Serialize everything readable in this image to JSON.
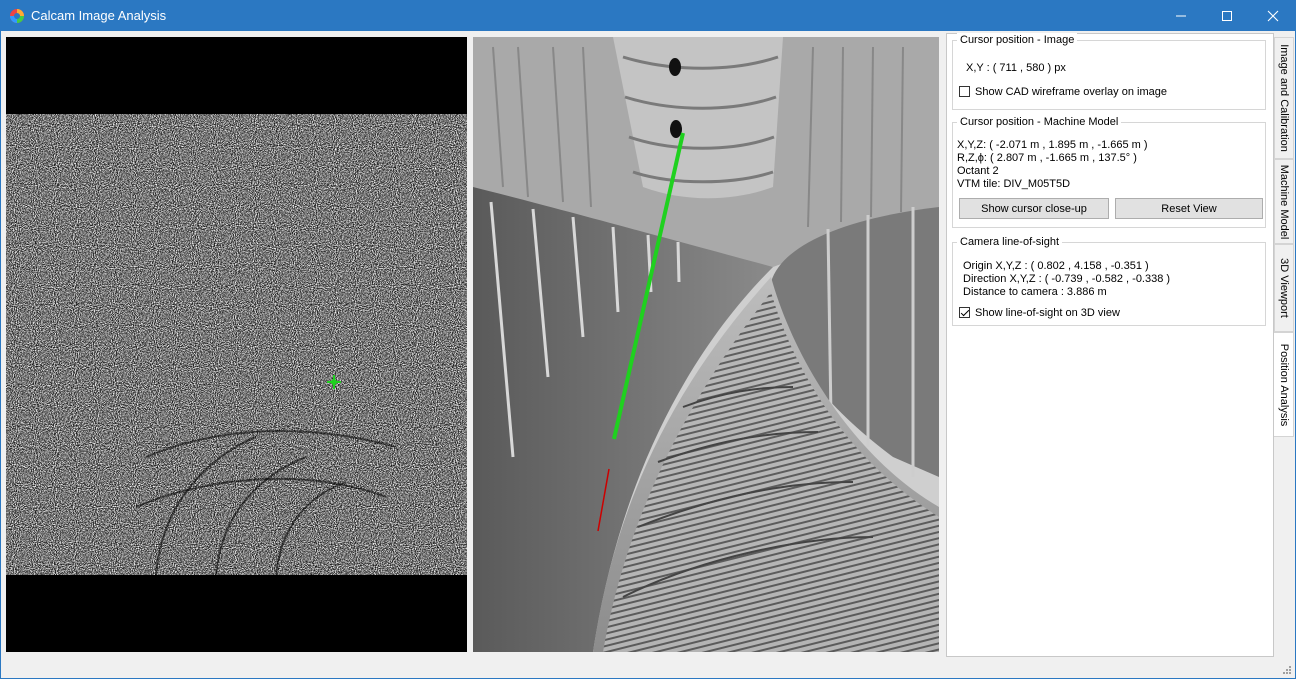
{
  "window": {
    "title": "Calcam Image Analysis"
  },
  "panel": {
    "cursor_image": {
      "title": "Cursor position - Image",
      "xy": "X,Y : ( 711 , 580 ) px",
      "overlay_label": "Show CAD wireframe overlay on image",
      "overlay_checked": false
    },
    "cursor_model": {
      "title": "Cursor position - Machine Model",
      "xyz": "X,Y,Z: ( -2.071 m , 1.895 m , -1.665 m )",
      "rzphi": "R,Z,ϕ: ( 2.807 m , -1.665 m , 137.5° )",
      "octant": "Octant 2",
      "vtm": "VTM tile: DIV_M05T5D",
      "closeup_button": "Show cursor close-up",
      "reset_button": "Reset View"
    },
    "line_of_sight": {
      "title": "Camera line-of-sight",
      "origin": "Origin X,Y,Z : ( 0.802 , 4.158 , -0.351 )",
      "direction": "Direction X,Y,Z : ( -0.739 , -0.582 , -0.338 )",
      "distance": "Distance to camera : 3.886 m",
      "show_label": "Show line-of-sight on 3D view",
      "show_checked": true
    }
  },
  "tabs": [
    {
      "label": "Image and Calibration",
      "active": false
    },
    {
      "label": "Machine Model",
      "active": false
    },
    {
      "label": "3D Viewport",
      "active": false
    },
    {
      "label": "Position Analysis",
      "active": true
    }
  ],
  "colors": {
    "titlebar": "#2b78c2",
    "cursor_marker": "#1fd11f",
    "sight_line": "#1fd11f",
    "sight_line_behind": "#cc0000"
  },
  "icons": {
    "app": "calcam-logo-icon",
    "minimize": "minimize-icon",
    "maximize": "maximize-icon",
    "close": "close-icon"
  }
}
